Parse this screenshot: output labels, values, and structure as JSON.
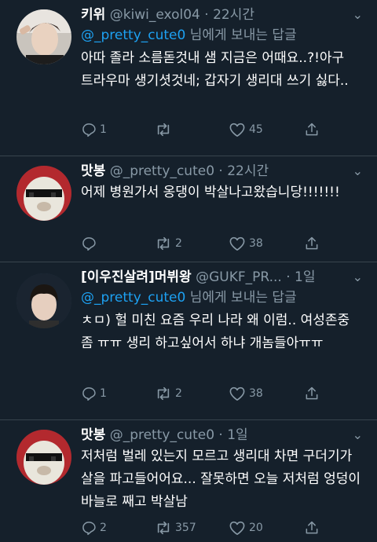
{
  "tweets": [
    {
      "name": "키위",
      "handle": "@kiwi_exol04",
      "sep": " · ",
      "time": "22시간",
      "replying_mention": "@_pretty_cute0",
      "replying_suffix": " 님에게 보내는 답글",
      "text": "아따 졸라 소름돋것내 샘 지금은 어때요..?!아구 트라우마 생기셧것네; 갑자기 생리대 쓰기 싫다..",
      "replies": "1",
      "retweets": "",
      "likes": "45"
    },
    {
      "name": "맛봉",
      "handle": "@_pretty_cute0",
      "sep": " · ",
      "time": "22시간",
      "text": "어제 병원가서 옹댕이 박살나고왔습니당!!!!!!!",
      "replies": "",
      "retweets": "2",
      "likes": "38"
    },
    {
      "name": "[이우진살려]머뷔왕",
      "handle": "@GUKF_PR...",
      "sep": " · ",
      "time": "1일",
      "replying_mention": "@_pretty_cute0",
      "replying_suffix": " 님에게 보내는 답글",
      "text": "ㅊㅁ) 헐 미친 요즘 우리 나라 왜 이럼.. 여성존중 좀 ㅠㅠ 생리 하고싶어서 하냐 개놈들아ㅠㅠ",
      "replies": "1",
      "retweets": "2",
      "likes": "38"
    },
    {
      "name": "맛봉",
      "handle": "@_pretty_cute0",
      "sep": " · ",
      "time": "1일",
      "text": "저처럼 벌레 있는지 모르고 생리대 차면 구더기가 살을 파고들어어요... 잘못하면 오늘 저처럼 엉덩이 바늘로 째고 박살남",
      "replies": "2",
      "retweets": "357",
      "likes": "20"
    }
  ],
  "colors": {
    "background": "#15202b",
    "text": "#ffffff",
    "secondary": "#8899a6",
    "link": "#1da1f2",
    "divider": "#38444d"
  },
  "icons": [
    "reply-icon",
    "retweet-icon",
    "like-icon",
    "share-icon",
    "chevron-down-icon"
  ]
}
